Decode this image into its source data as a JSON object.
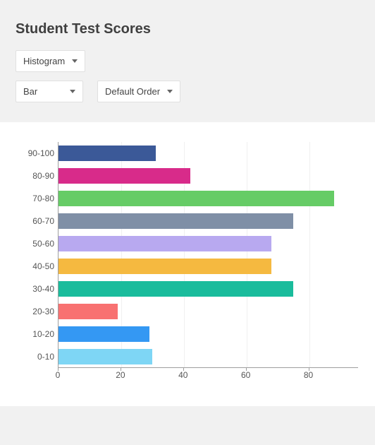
{
  "title": "Student Test Scores",
  "controls": {
    "chart_mode": "Histogram",
    "bar_type": "Bar",
    "sort_order": "Default Order"
  },
  "chart_data": {
    "type": "bar",
    "orientation": "horizontal",
    "title": "Student Test Scores",
    "xlabel": "",
    "ylabel": "",
    "xlim": [
      0,
      90
    ],
    "x_ticks": [
      0,
      20,
      40,
      60,
      80
    ],
    "categories": [
      "90-100",
      "80-90",
      "70-80",
      "60-70",
      "50-60",
      "40-50",
      "30-40",
      "20-30",
      "10-20",
      "0-10"
    ],
    "values": [
      31,
      42,
      88,
      75,
      68,
      68,
      75,
      19,
      29,
      30
    ],
    "colors": [
      "#3b5998",
      "#d82b8a",
      "#66cc66",
      "#7f8fa6",
      "#b8a9f0",
      "#f5b940",
      "#1abc9c",
      "#f87171",
      "#3498f3",
      "#7ed6f5"
    ]
  }
}
